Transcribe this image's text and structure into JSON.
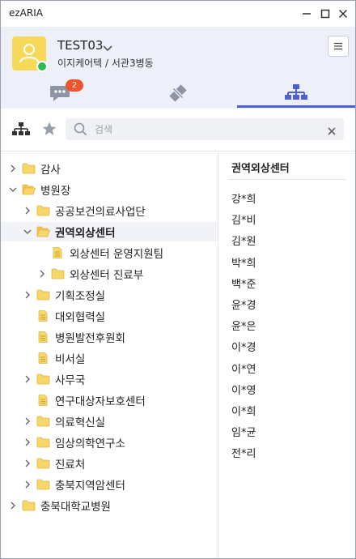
{
  "app": {
    "title": "ezARIA"
  },
  "user": {
    "name": "TEST03",
    "org": "이지케어텍 / 서관3병동",
    "status_color": "#2dbb55"
  },
  "tabs": [
    {
      "icon": "chat-icon",
      "badge": "2"
    },
    {
      "icon": "collapse-icon"
    },
    {
      "icon": "organization-icon",
      "active": true
    }
  ],
  "search": {
    "placeholder": "검색",
    "value": ""
  },
  "tree": [
    {
      "label": "감사",
      "type": "folder",
      "caret": "right",
      "level": 0
    },
    {
      "label": "병원장",
      "type": "folder-open",
      "caret": "down",
      "level": 0
    },
    {
      "label": "공공보건의료사업단",
      "type": "folder",
      "caret": "right",
      "level": 1
    },
    {
      "label": "권역외상센터",
      "type": "folder-open",
      "caret": "down",
      "level": 1,
      "selected": true
    },
    {
      "label": "외상센터 운영지원팀",
      "type": "doc",
      "caret": "none",
      "level": 2
    },
    {
      "label": "외상센터 진료부",
      "type": "folder",
      "caret": "right",
      "level": 2
    },
    {
      "label": "기획조정실",
      "type": "folder",
      "caret": "right",
      "level": 1
    },
    {
      "label": "대외협력실",
      "type": "doc",
      "caret": "none",
      "level": 1
    },
    {
      "label": "병원발전후원회",
      "type": "doc",
      "caret": "none",
      "level": 1
    },
    {
      "label": "비서실",
      "type": "doc",
      "caret": "none",
      "level": 1
    },
    {
      "label": "사무국",
      "type": "folder",
      "caret": "right",
      "level": 1
    },
    {
      "label": "연구대상자보호센터",
      "type": "doc",
      "caret": "none",
      "level": 1
    },
    {
      "label": "의료혁신실",
      "type": "folder",
      "caret": "right",
      "level": 1
    },
    {
      "label": "임상의학연구소",
      "type": "folder",
      "caret": "right",
      "level": 1
    },
    {
      "label": "진료처",
      "type": "folder",
      "caret": "right",
      "level": 1
    },
    {
      "label": "충북지역암센터",
      "type": "folder",
      "caret": "right",
      "level": 1
    },
    {
      "label": "충북대학교병원",
      "type": "folder",
      "caret": "right",
      "level": 0
    }
  ],
  "members": {
    "title": "권역외상센터",
    "list": [
      "강*희",
      "김*비",
      "김*원",
      "박*희",
      "백*준",
      "윤*경",
      "윤*은",
      "이*경",
      "이*연",
      "이*영",
      "이*희",
      "임*균",
      "전*리"
    ]
  },
  "colors": {
    "accent": "#4f5fd8",
    "folder": "#f7d66a",
    "header_bg": "#eef0f9",
    "badge": "#f0532e"
  }
}
